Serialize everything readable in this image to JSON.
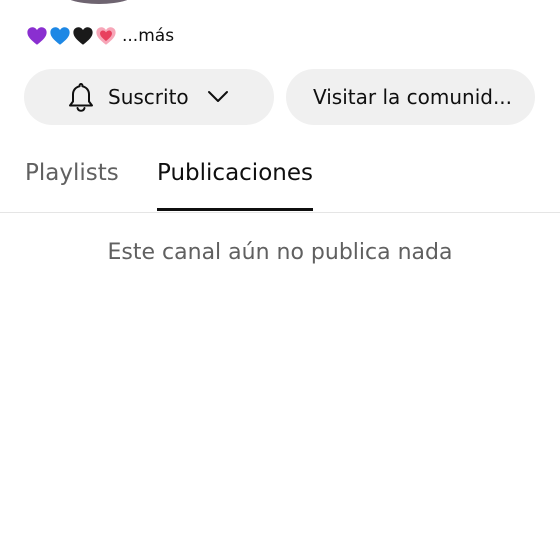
{
  "channel": {
    "description_emojis": [
      "purple-heart",
      "blue-heart",
      "black-heart",
      "growing-heart"
    ],
    "more_label": "...más"
  },
  "actions": {
    "subscribed_label": "Suscrito",
    "subscribed_icon": "bell-icon",
    "dropdown_icon": "chevron-down-icon",
    "community_label": "Visitar la comunid..."
  },
  "tabs": [
    {
      "label": "Playlists",
      "active": false
    },
    {
      "label": "Publicaciones",
      "active": true
    }
  ],
  "empty_state": {
    "message": "Este canal aún no publica nada"
  },
  "colors": {
    "button_bg": "#f0f0f0",
    "text_primary": "#0f0f0f",
    "text_secondary": "#606060",
    "divider": "#e5e5e5",
    "purple_heart": "#8a2fd0",
    "blue_heart": "#1e88e5",
    "black_heart": "#1a1a1a",
    "pink_heart": "#f26b86"
  }
}
